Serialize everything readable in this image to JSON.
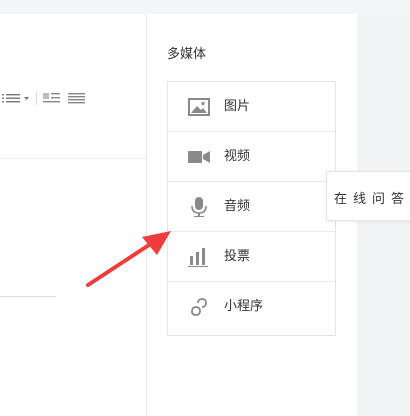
{
  "panel": {
    "title": "多媒体",
    "items": [
      {
        "label": "图片",
        "icon": "image-icon"
      },
      {
        "label": "视频",
        "icon": "video-camera-icon"
      },
      {
        "label": "音频",
        "icon": "microphone-icon"
      },
      {
        "label": "投票",
        "icon": "bar-chart-icon"
      },
      {
        "label": "小程序",
        "icon": "mini-program-icon"
      }
    ]
  },
  "tooltip": {
    "text": "在线问答"
  },
  "colors": {
    "arrow": "#f03c3c",
    "icon": "#8a8a8a",
    "border": "#e4e4e4"
  }
}
